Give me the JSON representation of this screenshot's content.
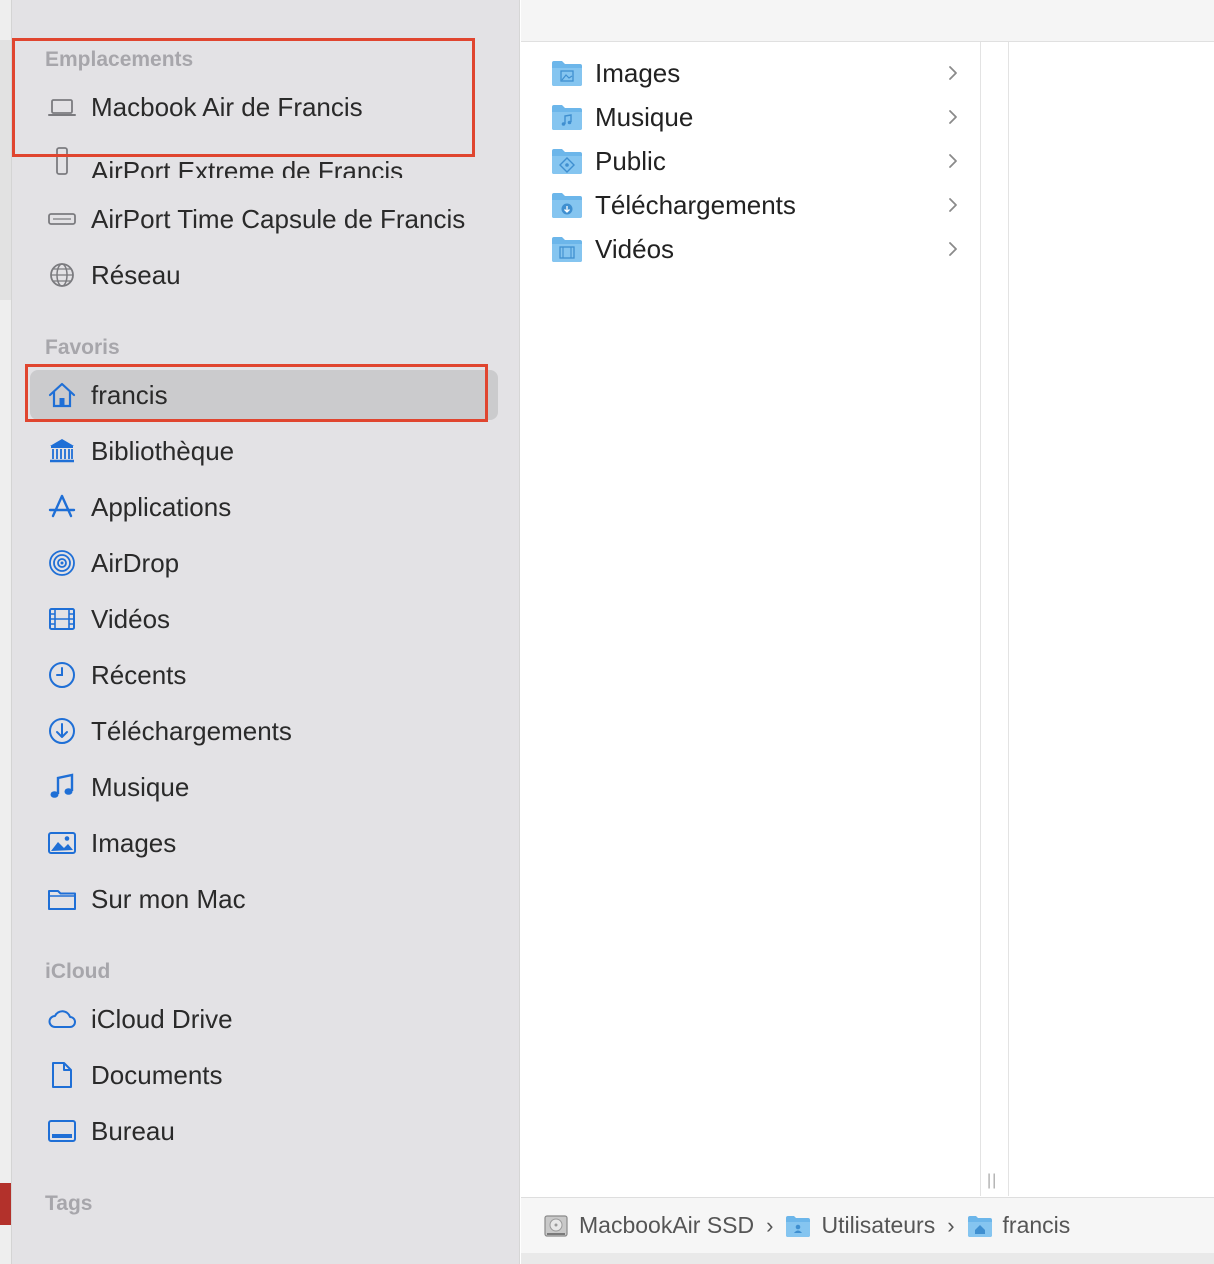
{
  "sidebar": {
    "sections": {
      "locations": "Emplacements",
      "favorites": "Favoris",
      "icloud": "iCloud",
      "tags": "Tags"
    },
    "locations": [
      {
        "label": "Macbook Air de Francis",
        "icon": "laptop-icon"
      },
      {
        "label": "AirPort Extreme de Francis",
        "icon": "airport-extreme-icon"
      },
      {
        "label": "AirPort Time Capsule de Francis",
        "icon": "time-capsule-icon"
      },
      {
        "label": "Réseau",
        "icon": "globe-icon"
      }
    ],
    "favorites": [
      {
        "label": "francis",
        "icon": "home-icon",
        "selected": true
      },
      {
        "label": "Bibliothèque",
        "icon": "library-icon"
      },
      {
        "label": "Applications",
        "icon": "applications-icon"
      },
      {
        "label": "AirDrop",
        "icon": "airdrop-icon"
      },
      {
        "label": "Vidéos",
        "icon": "film-icon"
      },
      {
        "label": "Récents",
        "icon": "clock-icon"
      },
      {
        "label": "Téléchargements",
        "icon": "download-icon"
      },
      {
        "label": "Musique",
        "icon": "music-note-icon"
      },
      {
        "label": "Images",
        "icon": "photo-icon"
      },
      {
        "label": "Sur mon Mac",
        "icon": "folder-icon"
      }
    ],
    "icloud": [
      {
        "label": "iCloud Drive",
        "icon": "cloud-icon"
      },
      {
        "label": "Documents",
        "icon": "document-icon"
      },
      {
        "label": "Bureau",
        "icon": "desktop-icon"
      }
    ]
  },
  "column": {
    "items": [
      {
        "name": "Images",
        "icon": "images-folder-icon"
      },
      {
        "name": "Musique",
        "icon": "music-folder-icon"
      },
      {
        "name": "Public",
        "icon": "public-folder-icon"
      },
      {
        "name": "Téléchargements",
        "icon": "downloads-folder-icon"
      },
      {
        "name": "Vidéos",
        "icon": "movies-folder-icon"
      }
    ],
    "resize_handle": "||"
  },
  "pathbar": {
    "crumbs": [
      {
        "label": "MacbookAir SSD",
        "icon": "disk-icon"
      },
      {
        "label": "Utilisateurs",
        "icon": "users-folder-icon"
      },
      {
        "label": "francis",
        "icon": "home-folder-icon"
      }
    ],
    "separator": "›"
  },
  "colors": {
    "sidebar_bg": "#e3e2e5",
    "accent": "#1f6fd6",
    "highlight_box": "#e0452f",
    "selected_bg": "#cbcbcd",
    "folder": "#6cb6ea"
  }
}
